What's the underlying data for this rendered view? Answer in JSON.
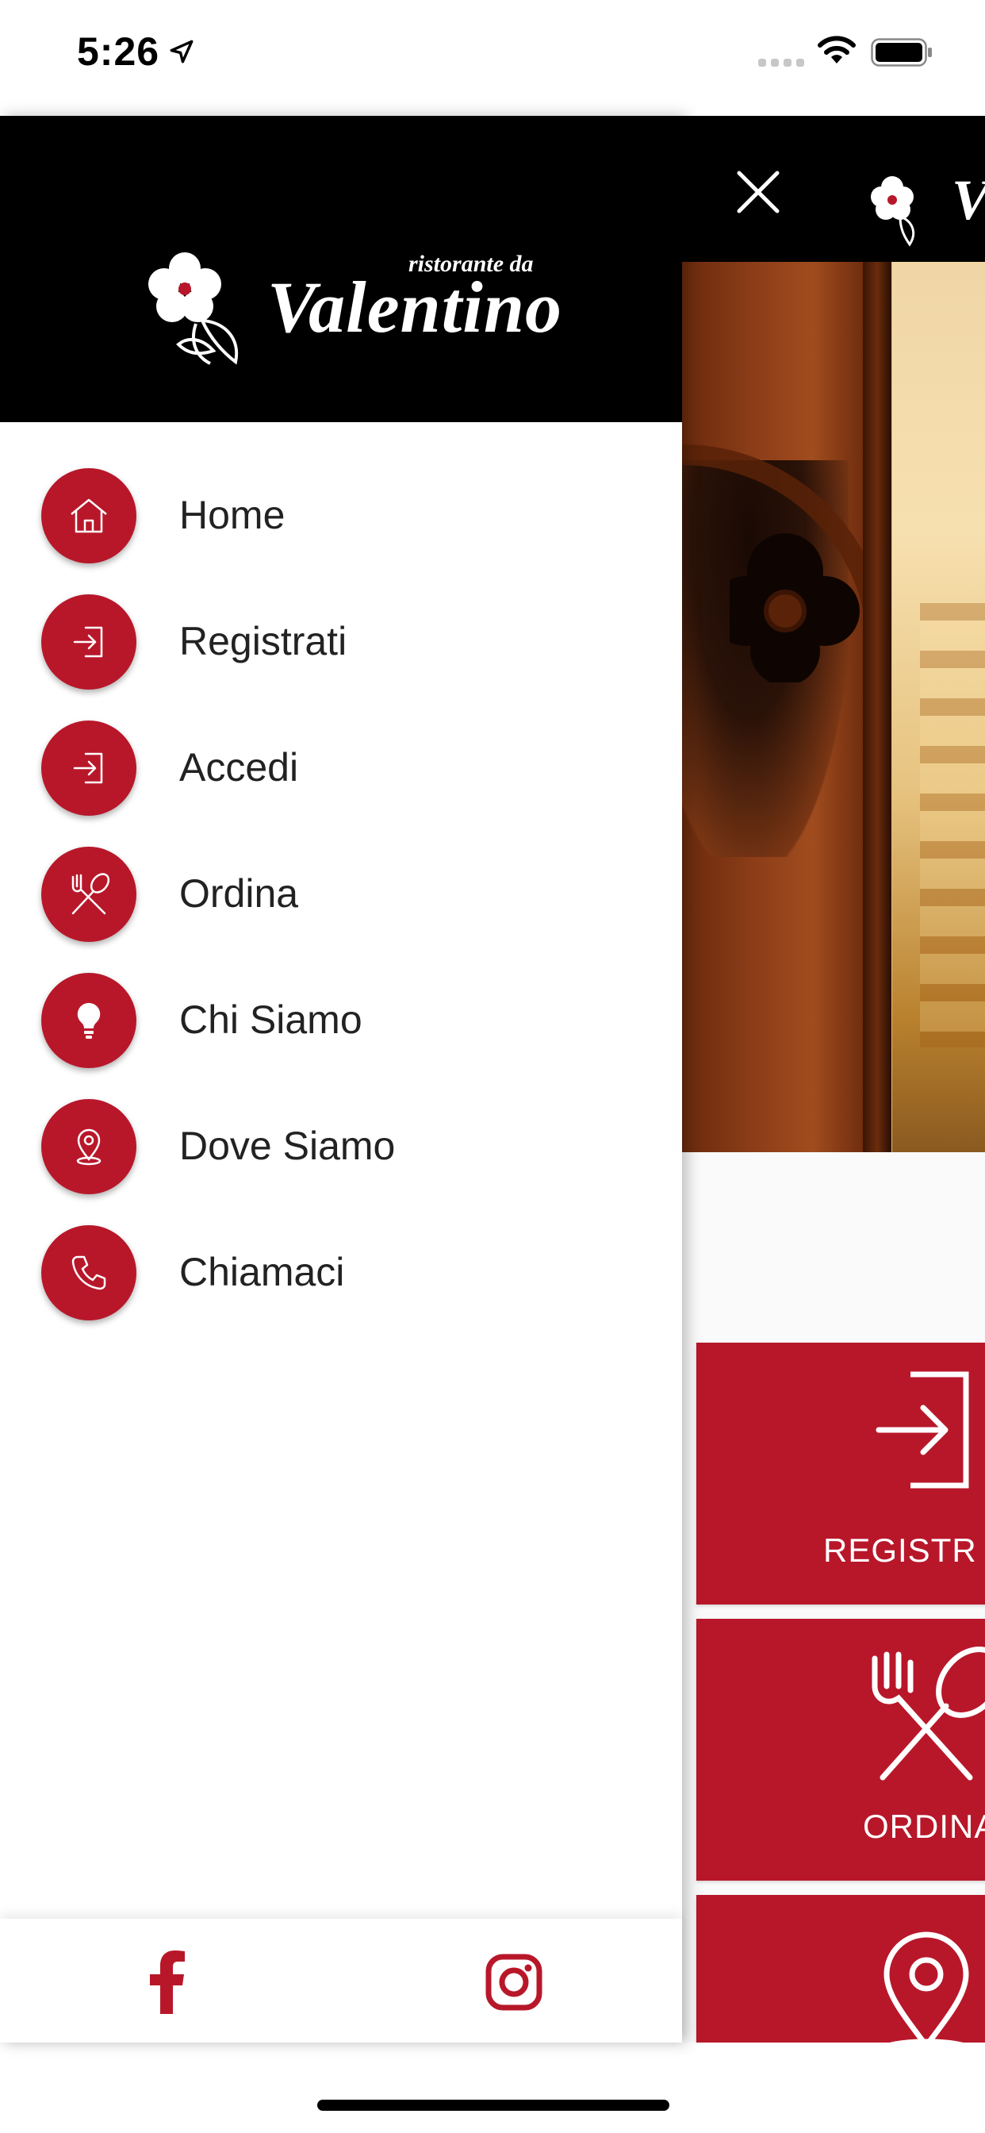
{
  "status_bar": {
    "time": "5:26",
    "icons": [
      "location-arrow-icon",
      "signal-icon",
      "wifi-icon",
      "battery-icon"
    ]
  },
  "brand": {
    "small_text": "ristorante da",
    "name": "Valentino",
    "accent_color": "#b8172a",
    "header_bg": "#000000"
  },
  "menu": {
    "items": [
      {
        "label": "Home",
        "icon": "home-icon"
      },
      {
        "label": "Registrati",
        "icon": "sign-in-icon"
      },
      {
        "label": "Accedi",
        "icon": "sign-in-icon"
      },
      {
        "label": "Ordina",
        "icon": "fork-spoon-icon"
      },
      {
        "label": "Chi Siamo",
        "icon": "lightbulb-icon"
      },
      {
        "label": "Dove Siamo",
        "icon": "map-pin-icon"
      },
      {
        "label": "Chiamaci",
        "icon": "phone-icon"
      }
    ]
  },
  "social": {
    "icons": [
      "facebook-icon",
      "instagram-icon"
    ]
  },
  "main": {
    "header_icons": [
      "close-icon"
    ],
    "tiles": [
      {
        "label": "REGISTR",
        "icon": "sign-in-icon"
      },
      {
        "label": "ORDINA",
        "icon": "fork-spoon-icon"
      },
      {
        "label": "",
        "icon": "map-pin-icon"
      }
    ]
  }
}
